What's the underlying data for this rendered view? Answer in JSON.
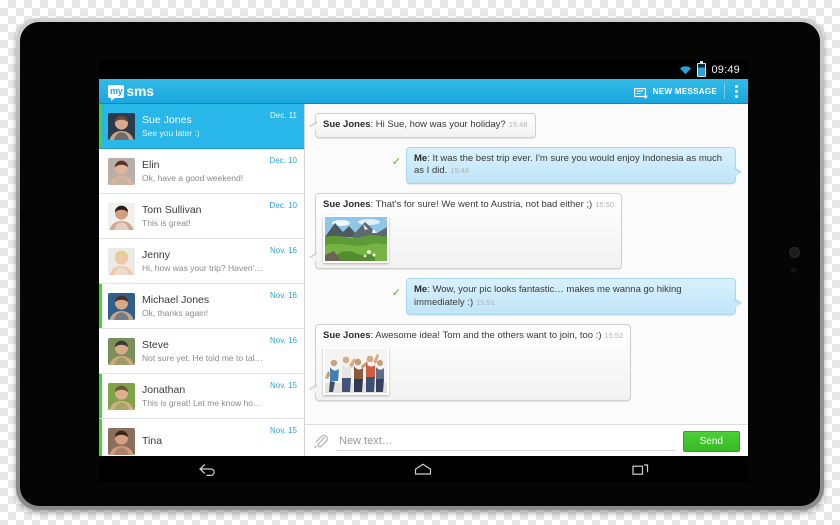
{
  "status_bar": {
    "time": "09:49",
    "wifi_icon": "wifi-icon",
    "battery_icon": "battery-icon"
  },
  "app_bar": {
    "logo_my": "my",
    "logo_sms": "sms",
    "new_message_label": "NEW MESSAGE",
    "new_message_icon": "new-message-icon",
    "overflow_icon": "overflow-menu-icon"
  },
  "conversations": [
    {
      "name": "Sue Jones",
      "preview": "See you later :)",
      "date": "Dec. 11",
      "active": true,
      "unread": true
    },
    {
      "name": "Elin",
      "preview": "Ok, have a good weekend!",
      "date": "Dec. 10",
      "active": false,
      "unread": false
    },
    {
      "name": "Tom Sullivan",
      "preview": "This is great!",
      "date": "Dec. 10",
      "active": false,
      "unread": false
    },
    {
      "name": "Jenny",
      "preview": "Hi, how was your trip? Haven't talk s…",
      "date": "Nov. 16",
      "active": false,
      "unread": false
    },
    {
      "name": "Michael Jones",
      "preview": "Ok, thanks again!",
      "date": "Nov. 16",
      "active": false,
      "unread": true
    },
    {
      "name": "Steve",
      "preview": "Not sure yet. He told me to talk with…",
      "date": "Nov. 16",
      "active": false,
      "unread": false
    },
    {
      "name": "Jonathan",
      "preview": "This is great! Let me know how it go…",
      "date": "Nov. 15",
      "active": false,
      "unread": true
    },
    {
      "name": "Tina",
      "preview": "",
      "date": "Nov. 15",
      "active": false,
      "unread": true
    }
  ],
  "messages": [
    {
      "direction": "in",
      "sender": "Sue Jones",
      "text": ": Hi Sue, how was your holiday?",
      "time": "15:48",
      "photo": null,
      "delivered": false
    },
    {
      "direction": "out",
      "sender": "Me",
      "text": ": It was the best trip ever. I'm sure you would enjoy Indonesia as much as I did.",
      "time": "15:48",
      "photo": null,
      "delivered": true
    },
    {
      "direction": "in",
      "sender": "Sue Jones",
      "text": ": That's for sure! We went to Austria, not bad either ;)",
      "time": "15:50",
      "photo": "mountain-photo",
      "delivered": false
    },
    {
      "direction": "out",
      "sender": "Me",
      "text": ": Wow, your pic looks fantastic… makes me wanna go hiking immediately :)",
      "time": "15:51",
      "photo": null,
      "delivered": true
    },
    {
      "direction": "in",
      "sender": "Sue Jones",
      "text": ": Awesome idea! Tom and the others want to join, too :)",
      "time": "15:52",
      "photo": "group-photo",
      "delivered": false
    }
  ],
  "composer": {
    "attach_icon": "paperclip-icon",
    "input_placeholder": "New text…",
    "input_value": "",
    "send_label": "Send"
  },
  "nav_bar": {
    "back_icon": "back-icon",
    "home_icon": "home-icon",
    "recents_icon": "recents-icon"
  },
  "colors": {
    "accent_blue": "#29b6e8",
    "app_bar_blue": "#1ba7de",
    "unread_green": "#3ddb2e",
    "send_green": "#36bb24",
    "date_blue": "#2ba6d8",
    "check_green": "#5ab52f"
  }
}
